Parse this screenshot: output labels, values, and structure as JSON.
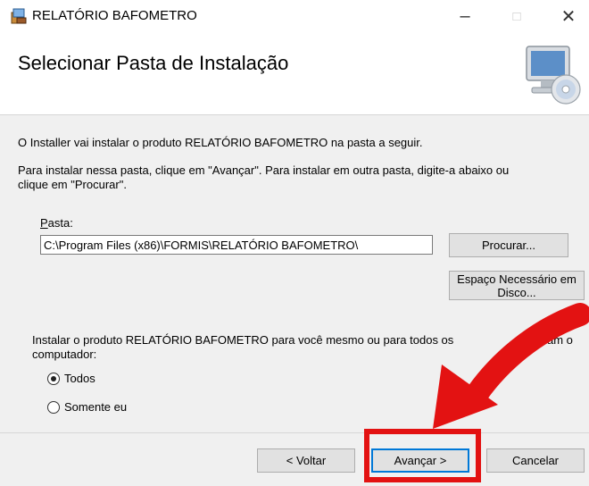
{
  "window": {
    "title": "RELATÓRIO BAFOMETRO",
    "minimize_glyph": "–",
    "maximize_glyph": "□",
    "close_glyph": "✕"
  },
  "header": {
    "title": "Selecionar Pasta de Instalação",
    "graphic_icon": "computer-cd-icon"
  },
  "content": {
    "intro": "O Installer vai instalar o produto RELATÓRIO BAFOMETRO na pasta a seguir.",
    "instructions_line1": "Para instalar nessa pasta, clique em \"Avançar\". Para instalar em outra pasta, digite-a abaixo ou",
    "instructions_line2": "clique em \"Procurar\".",
    "folder_label_first": "P",
    "folder_label_rest": "asta:",
    "folder_value": "C:\\Program Files (x86)\\FORMIS\\RELATÓRIO BAFOMETRO\\",
    "browse_label": "Procurar...",
    "disk_cost_line1": "Espaço Necessário em",
    "disk_cost_line2": "Disco...",
    "install_for_line1": "Instalar o produto RELATÓRIO BAFOMETRO para você mesmo ou para todos os",
    "install_for_line1_tail": "am o",
    "install_for_line2": "computador:",
    "radio_everyone": "Todos",
    "radio_just_me": "Somente eu",
    "selected_option": "Todos"
  },
  "footer": {
    "back_label": "< Voltar",
    "next_label": "Avançar >",
    "cancel_label": "Cancelar"
  },
  "annotation": {
    "color": "#e31212"
  }
}
